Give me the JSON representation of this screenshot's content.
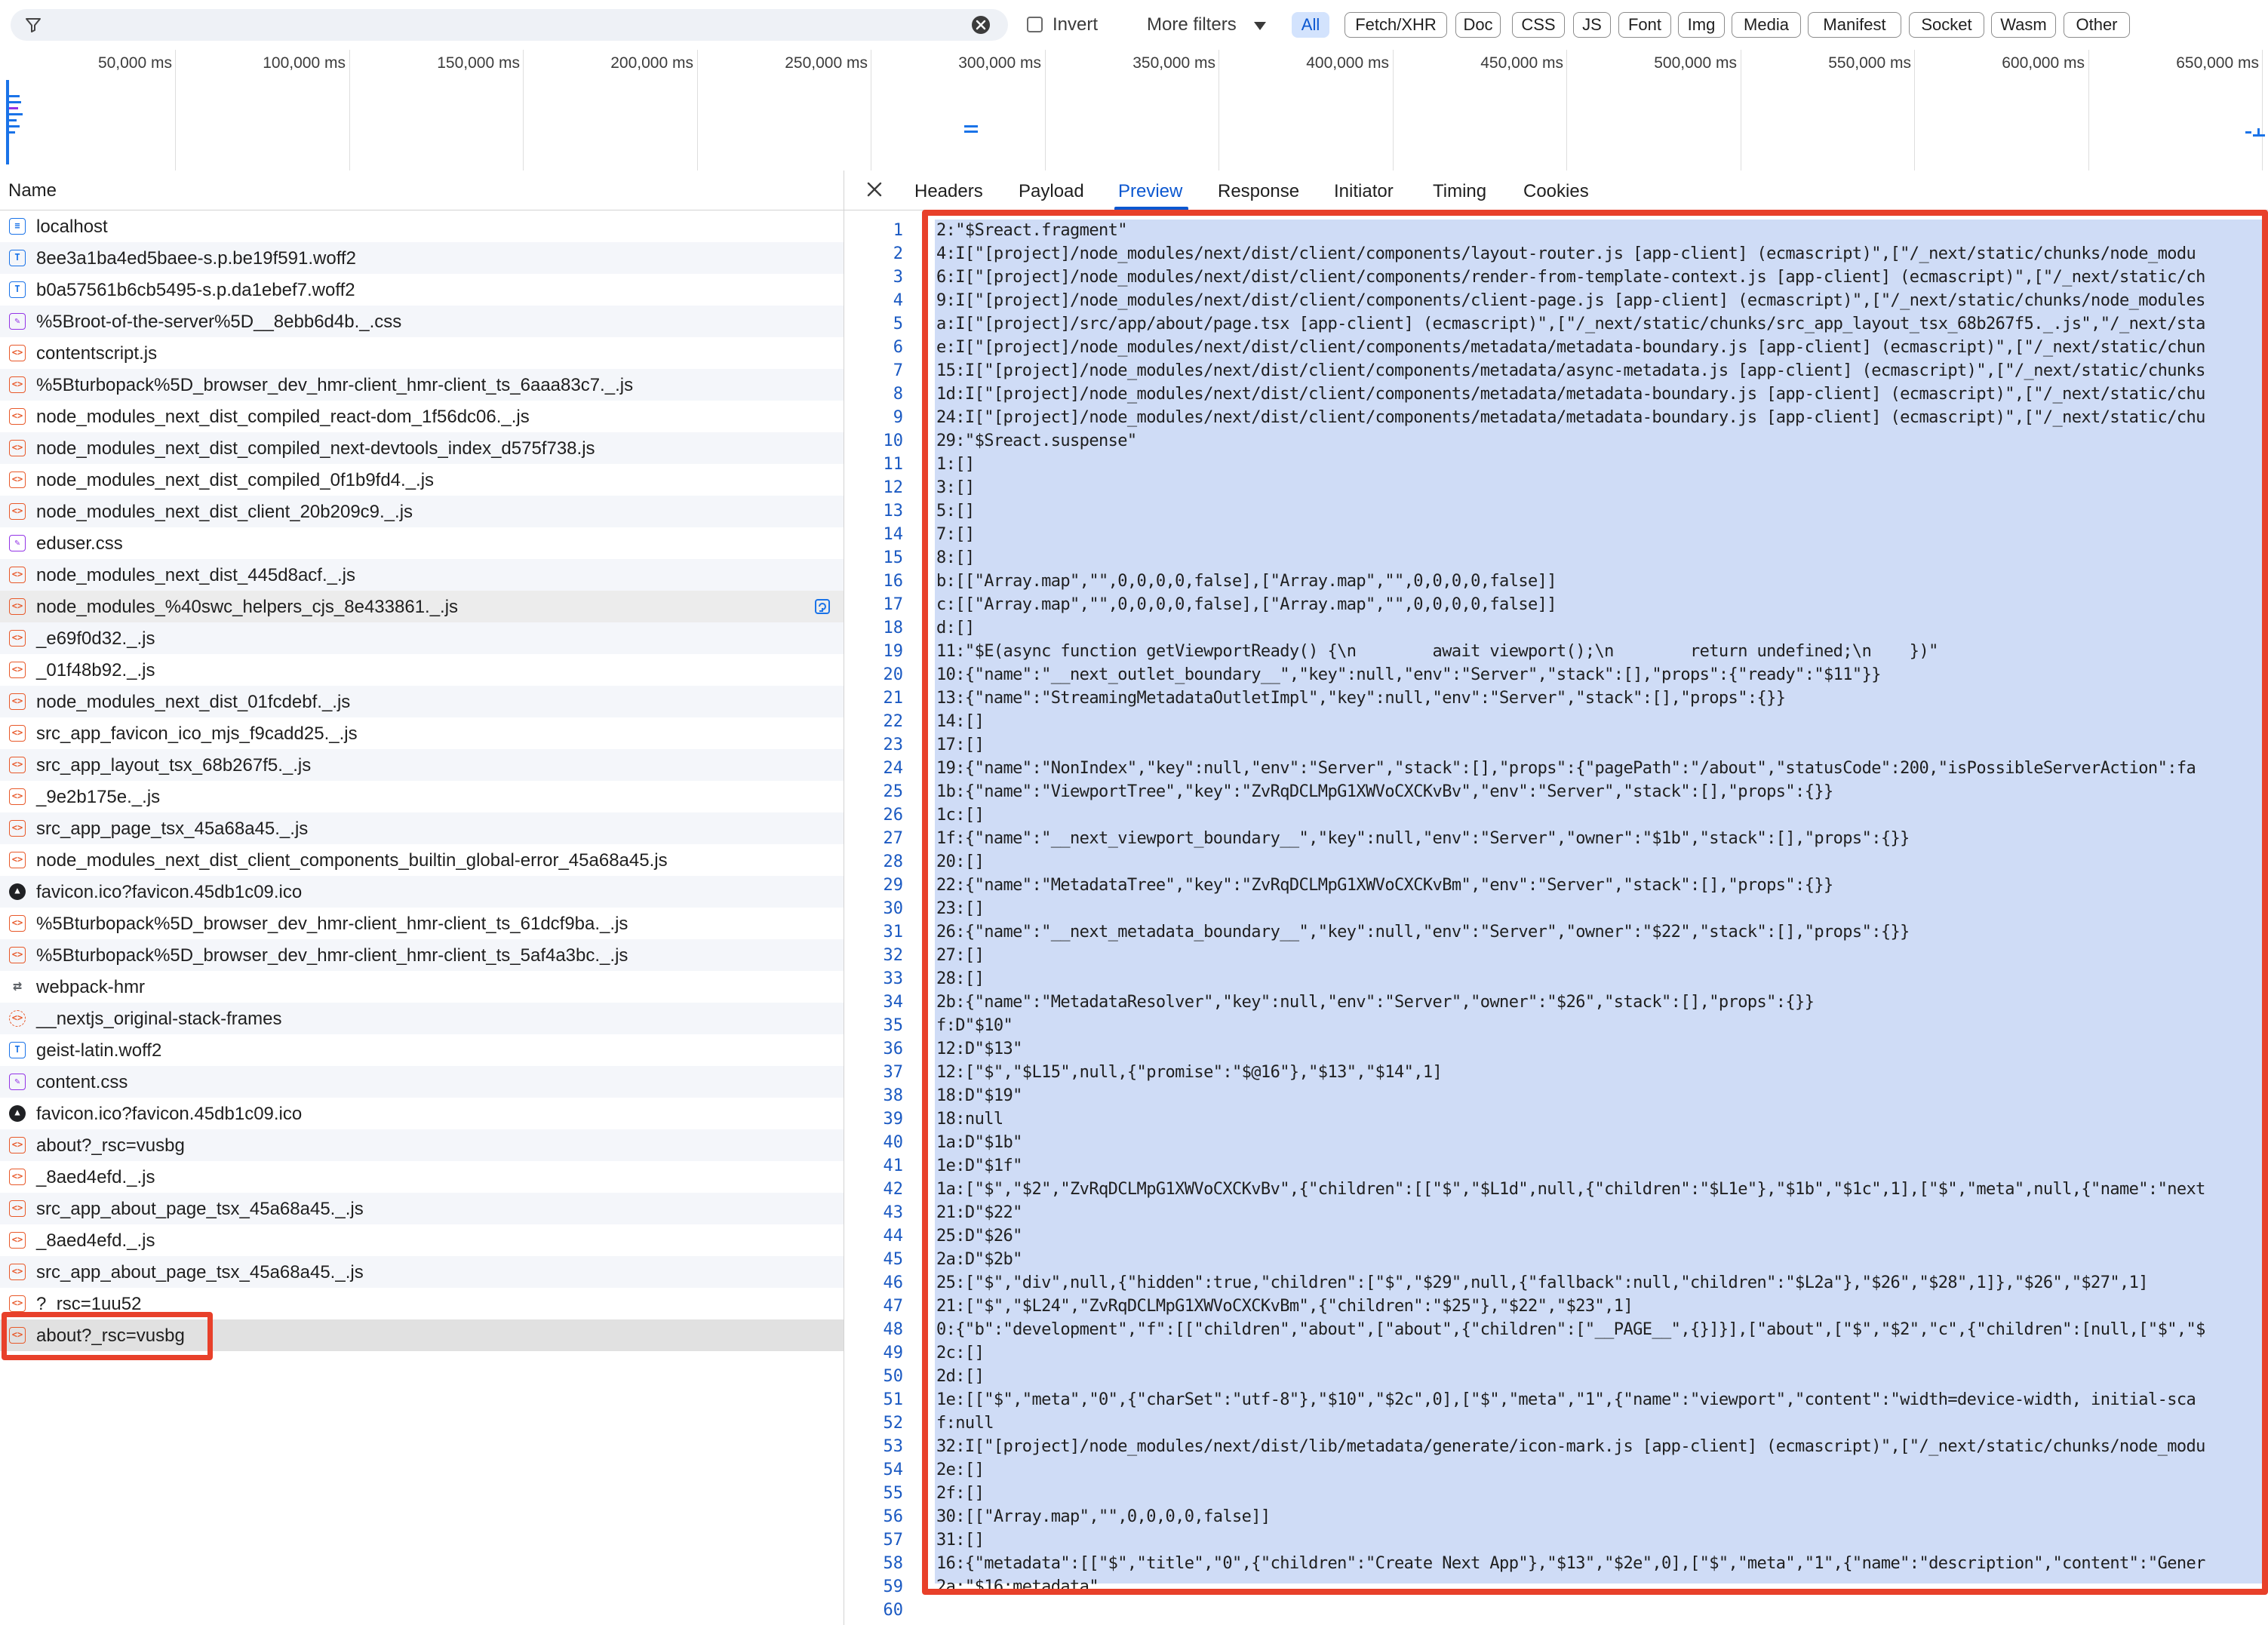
{
  "filter_bar": {
    "filter_value": "",
    "invert_label": "Invert",
    "invert_checked": false,
    "more_filters_label": "More filters",
    "chips": [
      "All",
      "Fetch/XHR",
      "Doc",
      "CSS",
      "JS",
      "Font",
      "Img",
      "Media",
      "Manifest",
      "Socket",
      "Wasm",
      "Other"
    ],
    "active_chip": "All"
  },
  "overview": {
    "ticks": [
      "50,000 ms",
      "100,000 ms",
      "150,000 ms",
      "200,000 ms",
      "250,000 ms",
      "300,000 ms",
      "350,000 ms",
      "400,000 ms",
      "450,000 ms",
      "500,000 ms",
      "550,000 ms",
      "600,000 ms",
      "650,000 ms"
    ]
  },
  "request_list": {
    "header": "Name",
    "rows": [
      {
        "name": "localhost",
        "type": "doc"
      },
      {
        "name": "8ee3a1ba4ed5baee-s.p.be19f591.woff2",
        "type": "font"
      },
      {
        "name": "b0a57561b6cb5495-s.p.da1ebef7.woff2",
        "type": "font"
      },
      {
        "name": "%5Broot-of-the-server%5D__8ebb6d4b._.css",
        "type": "css"
      },
      {
        "name": "contentscript.js",
        "type": "script"
      },
      {
        "name": "%5Bturbopack%5D_browser_dev_hmr-client_hmr-client_ts_6aaa83c7._.js",
        "type": "script"
      },
      {
        "name": "node_modules_next_dist_compiled_react-dom_1f56dc06._.js",
        "type": "script"
      },
      {
        "name": "node_modules_next_dist_compiled_next-devtools_index_d575f738.js",
        "type": "script"
      },
      {
        "name": "node_modules_next_dist_compiled_0f1b9fd4._.js",
        "type": "script"
      },
      {
        "name": "node_modules_next_dist_client_20b209c9._.js",
        "type": "script"
      },
      {
        "name": "eduser.css",
        "type": "css"
      },
      {
        "name": "node_modules_next_dist_445d8acf._.js",
        "type": "script"
      },
      {
        "name": "node_modules_%40swc_helpers_cjs_8e433861._.js",
        "type": "script"
      },
      {
        "name": "_e69f0d32._.js",
        "type": "script"
      },
      {
        "name": "_01f48b92._.js",
        "type": "script"
      },
      {
        "name": "node_modules_next_dist_01fcdebf._.js",
        "type": "script"
      },
      {
        "name": "src_app_favicon_ico_mjs_f9cadd25._.js",
        "type": "script"
      },
      {
        "name": "src_app_layout_tsx_68b267f5._.js",
        "type": "script"
      },
      {
        "name": "_9e2b175e._.js",
        "type": "script"
      },
      {
        "name": "src_app_page_tsx_45a68a45._.js",
        "type": "script"
      },
      {
        "name": "node_modules_next_dist_client_components_builtin_global-error_45a68a45.js",
        "type": "script"
      },
      {
        "name": "favicon.ico?favicon.45db1c09.ico",
        "type": "img"
      },
      {
        "name": "%5Bturbopack%5D_browser_dev_hmr-client_hmr-client_ts_61dcf9ba._.js",
        "type": "script"
      },
      {
        "name": "%5Bturbopack%5D_browser_dev_hmr-client_hmr-client_ts_5af4a3bc._.js",
        "type": "script"
      },
      {
        "name": "webpack-hmr",
        "type": "ws"
      },
      {
        "name": "__nextjs_original-stack-frames",
        "type": "fetch"
      },
      {
        "name": "geist-latin.woff2",
        "type": "font"
      },
      {
        "name": "content.css",
        "type": "css"
      },
      {
        "name": "favicon.ico?favicon.45db1c09.ico",
        "type": "img"
      },
      {
        "name": "about?_rsc=vusbg",
        "type": "script"
      },
      {
        "name": "_8aed4efd._.js",
        "type": "script"
      },
      {
        "name": "src_app_about_page_tsx_45a68a45._.js",
        "type": "script"
      },
      {
        "name": "_8aed4efd._.js",
        "type": "script"
      },
      {
        "name": "src_app_about_page_tsx_45a68a45._.js",
        "type": "script"
      },
      {
        "name": "?_rsc=1uu52",
        "type": "script"
      },
      {
        "name": "about?_rsc=vusbg",
        "type": "script"
      }
    ],
    "hover_row": 12,
    "selected_row": 35
  },
  "details": {
    "tabs": [
      "Headers",
      "Payload",
      "Preview",
      "Response",
      "Initiator",
      "Timing",
      "Cookies"
    ],
    "active_tab": "Preview",
    "lines": [
      "2:\"$Sreact.fragment\"",
      "4:I[\"[project]/node_modules/next/dist/client/components/layout-router.js [app-client] (ecmascript)\",[\"/_next/static/chunks/node_modu",
      "6:I[\"[project]/node_modules/next/dist/client/components/render-from-template-context.js [app-client] (ecmascript)\",[\"/_next/static/ch",
      "9:I[\"[project]/node_modules/next/dist/client/components/client-page.js [app-client] (ecmascript)\",[\"/_next/static/chunks/node_modules",
      "a:I[\"[project]/src/app/about/page.tsx [app-client] (ecmascript)\",[\"/_next/static/chunks/src_app_layout_tsx_68b267f5._.js\",\"/_next/sta",
      "e:I[\"[project]/node_modules/next/dist/client/components/metadata/metadata-boundary.js [app-client] (ecmascript)\",[\"/_next/static/chun",
      "15:I[\"[project]/node_modules/next/dist/client/components/metadata/async-metadata.js [app-client] (ecmascript)\",[\"/_next/static/chunks",
      "1d:I[\"[project]/node_modules/next/dist/client/components/metadata/metadata-boundary.js [app-client] (ecmascript)\",[\"/_next/static/chu",
      "24:I[\"[project]/node_modules/next/dist/client/components/metadata/metadata-boundary.js [app-client] (ecmascript)\",[\"/_next/static/chu",
      "29:\"$Sreact.suspense\"",
      "1:[]",
      "3:[]",
      "5:[]",
      "7:[]",
      "8:[]",
      "b:[[\"Array.map\",\"\",0,0,0,0,false],[\"Array.map\",\"\",0,0,0,0,false]]",
      "c:[[\"Array.map\",\"\",0,0,0,0,false],[\"Array.map\",\"\",0,0,0,0,false]]",
      "d:[]",
      "11:\"$E(async function getViewportReady() {\\n        await viewport();\\n        return undefined;\\n    })\"",
      "10:{\"name\":\"__next_outlet_boundary__\",\"key\":null,\"env\":\"Server\",\"stack\":[],\"props\":{\"ready\":\"$11\"}}",
      "13:{\"name\":\"StreamingMetadataOutletImpl\",\"key\":null,\"env\":\"Server\",\"stack\":[],\"props\":{}}",
      "14:[]",
      "17:[]",
      "19:{\"name\":\"NonIndex\",\"key\":null,\"env\":\"Server\",\"stack\":[],\"props\":{\"pagePath\":\"/about\",\"statusCode\":200,\"isPossibleServerAction\":fa",
      "1b:{\"name\":\"ViewportTree\",\"key\":\"ZvRqDCLMpG1XWVoCXCKvBv\",\"env\":\"Server\",\"stack\":[],\"props\":{}}",
      "1c:[]",
      "1f:{\"name\":\"__next_viewport_boundary__\",\"key\":null,\"env\":\"Server\",\"owner\":\"$1b\",\"stack\":[],\"props\":{}}",
      "20:[]",
      "22:{\"name\":\"MetadataTree\",\"key\":\"ZvRqDCLMpG1XWVoCXCKvBm\",\"env\":\"Server\",\"stack\":[],\"props\":{}}",
      "23:[]",
      "26:{\"name\":\"__next_metadata_boundary__\",\"key\":null,\"env\":\"Server\",\"owner\":\"$22\",\"stack\":[],\"props\":{}}",
      "27:[]",
      "28:[]",
      "2b:{\"name\":\"MetadataResolver\",\"key\":null,\"env\":\"Server\",\"owner\":\"$26\",\"stack\":[],\"props\":{}}",
      "f:D\"$10\"",
      "12:D\"$13\"",
      "12:[\"$\",\"$L15\",null,{\"promise\":\"$@16\"},\"$13\",\"$14\",1]",
      "18:D\"$19\"",
      "18:null",
      "1a:D\"$1b\"",
      "1e:D\"$1f\"",
      "1a:[\"$\",\"$2\",\"ZvRqDCLMpG1XWVoCXCKvBv\",{\"children\":[[\"$\",\"$L1d\",null,{\"children\":\"$L1e\"},\"$1b\",\"$1c\",1],[\"$\",\"meta\",null,{\"name\":\"next",
      "21:D\"$22\"",
      "25:D\"$26\"",
      "2a:D\"$2b\"",
      "25:[\"$\",\"div\",null,{\"hidden\":true,\"children\":[\"$\",\"$29\",null,{\"fallback\":null,\"children\":\"$L2a\"},\"$26\",\"$28\",1]},\"$26\",\"$27\",1]",
      "21:[\"$\",\"$L24\",\"ZvRqDCLMpG1XWVoCXCKvBm\",{\"children\":\"$25\"},\"$22\",\"$23\",1]",
      "0:{\"b\":\"development\",\"f\":[[\"children\",\"about\",[\"about\",{\"children\":[\"__PAGE__\",{}]}],[\"about\",[\"$\",\"$2\",\"c\",{\"children\":[null,[\"$\",\"$",
      "2c:[]",
      "2d:[]",
      "1e:[[\"$\",\"meta\",\"0\",{\"charSet\":\"utf-8\"},\"$10\",\"$2c\",0],[\"$\",\"meta\",\"1\",{\"name\":\"viewport\",\"content\":\"width=device-width, initial-sca",
      "f:null",
      "32:I[\"[project]/node_modules/next/dist/lib/metadata/generate/icon-mark.js [app-client] (ecmascript)\",[\"/_next/static/chunks/node_modu",
      "2e:[]",
      "2f:[]",
      "30:[[\"Array.map\",\"\",0,0,0,0,false]]",
      "31:[]",
      "16:{\"metadata\":[[\"$\",\"title\",\"0\",{\"children\":\"Create Next App\"},\"$13\",\"$2e\",0],[\"$\",\"meta\",\"1\",{\"name\":\"description\",\"content\":\"Gener",
      "2a:\"$16:metadata\"",
      ""
    ]
  },
  "colors": {
    "accent": "#0b57d0",
    "annotation_red": "#e8402a",
    "selection": "#cfdcf6",
    "script_icon": "#e8592a"
  }
}
